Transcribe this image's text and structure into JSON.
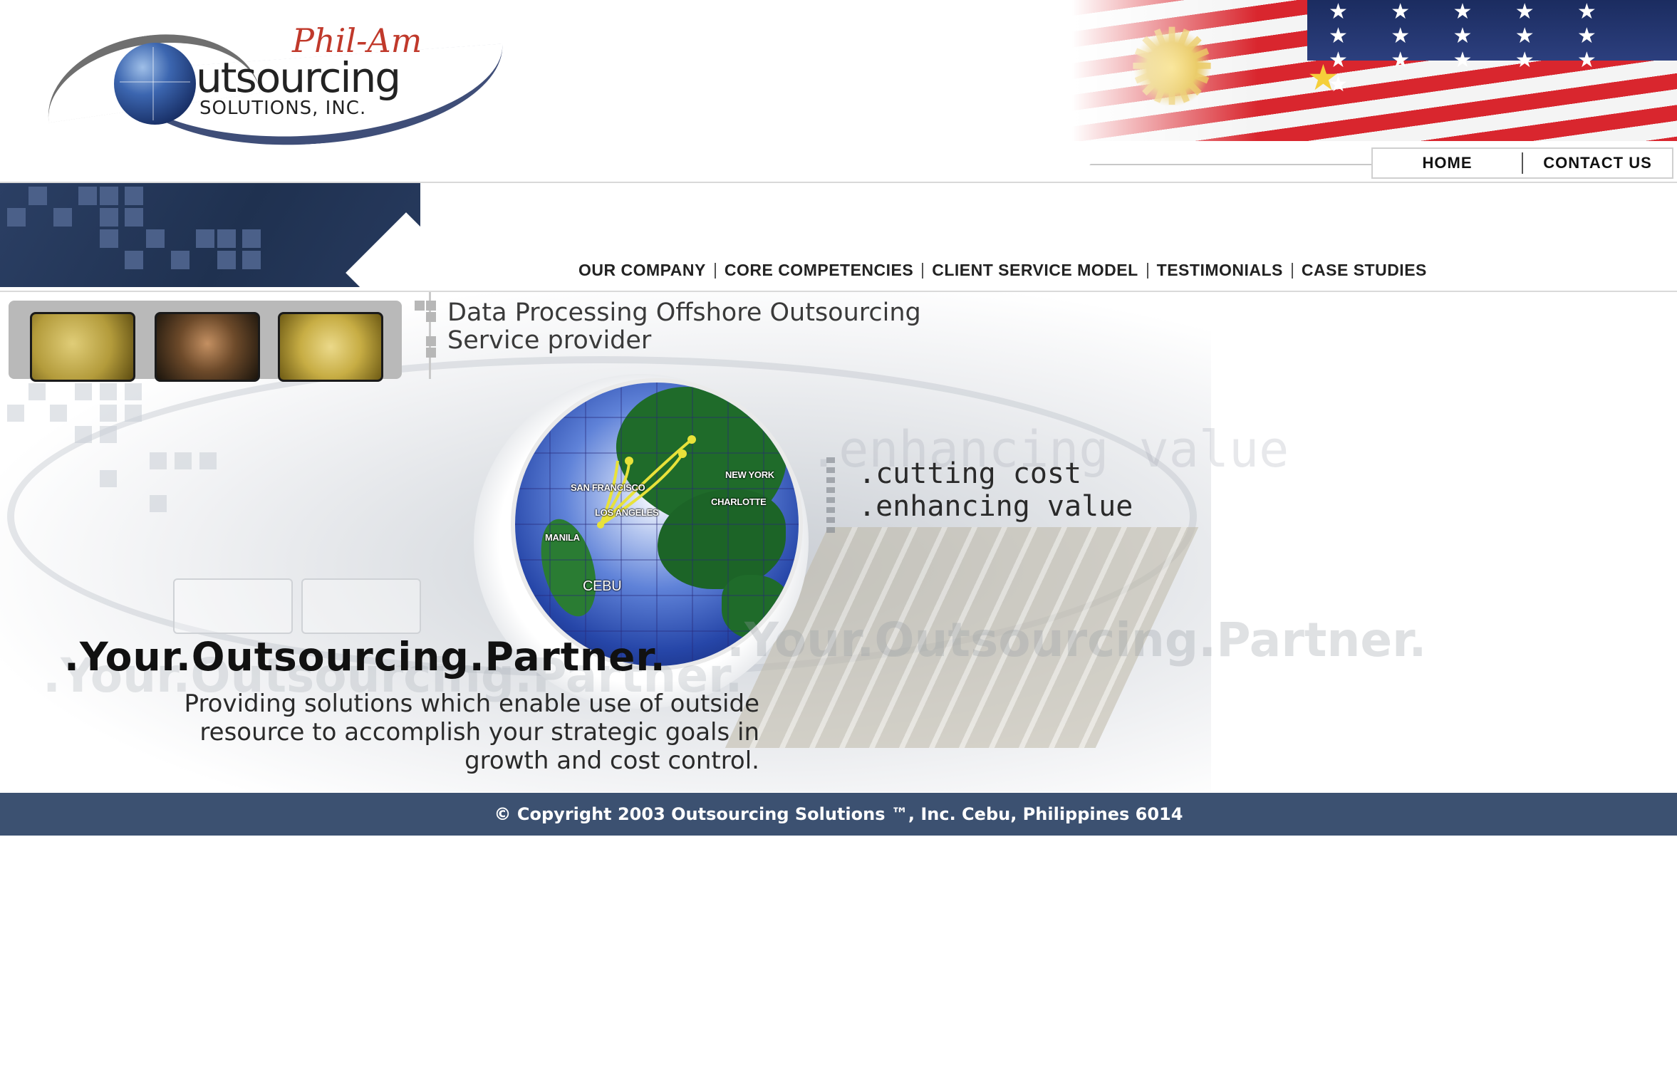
{
  "logo": {
    "script_text": "Phil-Am",
    "main_text": "utsourcing",
    "sub_text": "SOLUTIONS, INC."
  },
  "top_nav": {
    "items": [
      {
        "label": "HOME"
      },
      {
        "label": "CONTACT US"
      }
    ]
  },
  "main_nav": {
    "items": [
      {
        "label": "OUR COMPANY"
      },
      {
        "label": "CORE COMPETENCIES"
      },
      {
        "label": "CLIENT SERVICE MODEL"
      },
      {
        "label": "TESTIMONIALS"
      },
      {
        "label": "CASE STUDIES"
      }
    ]
  },
  "hero": {
    "heading_line1": "Data Processing Offshore Outsourcing",
    "heading_line2": "Service provider",
    "tagline_line1": ".cutting cost",
    "tagline_line2": ".enhancing value",
    "partner_title": ".Your.Outsourcing.Partner.",
    "description_line1": "Providing solutions which enable use of outside",
    "description_line2": "resource to accomplish your strategic goals in",
    "description_line3": "growth and cost control.",
    "map_labels": {
      "san_francisco": "SAN FRANCISCO",
      "los_angeles": "LOS ANGELES",
      "new_york": "NEW YORK",
      "charlotte": "CHARLOTTE",
      "manila": "MANILA",
      "cebu": "CEBU"
    }
  },
  "footer": {
    "copyright": "© Copyright 2003 Outsourcing Solutions ™, Inc. Cebu, Philippines 6014"
  },
  "colors": {
    "footer_bg": "#3c5171",
    "banner_navy": "#2b3f64",
    "flight_path": "#e8e23a"
  }
}
